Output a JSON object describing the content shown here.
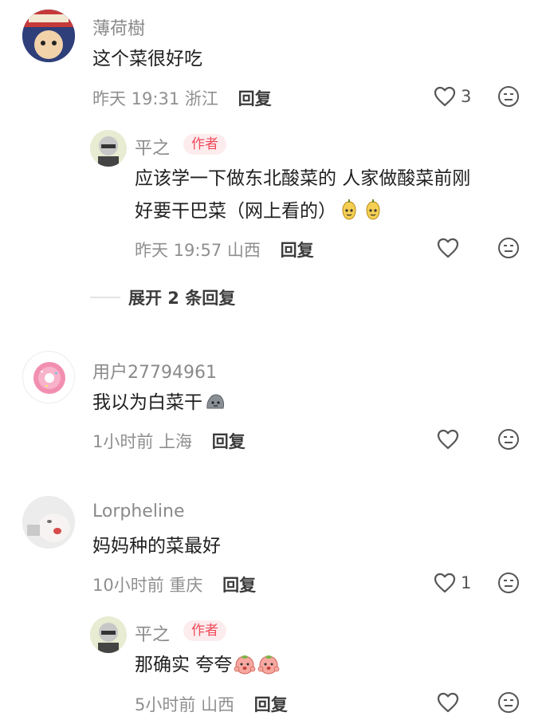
{
  "comments": [
    {
      "user": "薄荷樹",
      "text": "这个菜很好吃",
      "time": "昨天 19:31",
      "location": "浙江",
      "reply_label": "回复",
      "likes": "3",
      "replies": [
        {
          "user": "平之",
          "badge": "作者",
          "text_line1": "应该学一下做东北酸菜的 人家做酸菜前刚",
          "text_line2": "好要干巴菜（网上看的）",
          "time": "昨天 19:57",
          "location": "山西",
          "reply_label": "回复"
        }
      ],
      "expand_label": "展开 2 条回复"
    },
    {
      "user": "用户27794961",
      "text": "我以为白菜干",
      "time": "1小时前",
      "location": "上海",
      "reply_label": "回复"
    },
    {
      "user": "Lorpheline",
      "text": "妈妈种的菜最好",
      "time": "10小时前",
      "location": "重庆",
      "reply_label": "回复",
      "likes": "1",
      "replies": [
        {
          "user": "平之",
          "badge": "作者",
          "text": "那确实 夸夸",
          "time": "5小时前",
          "location": "山西",
          "reply_label": "回复"
        }
      ]
    }
  ],
  "icons": {
    "like": "heart-outline-icon",
    "dislike": "meh-face-icon",
    "emoji_1": "yellow-pear-emoji",
    "emoji_2": "gray-rock-emoji",
    "emoji_3": "peach-cheer-emoji"
  },
  "colors": {
    "badge_text": "#f04a5a",
    "badge_bg": "#fdecee",
    "meta_text": "#8f8f8f"
  }
}
